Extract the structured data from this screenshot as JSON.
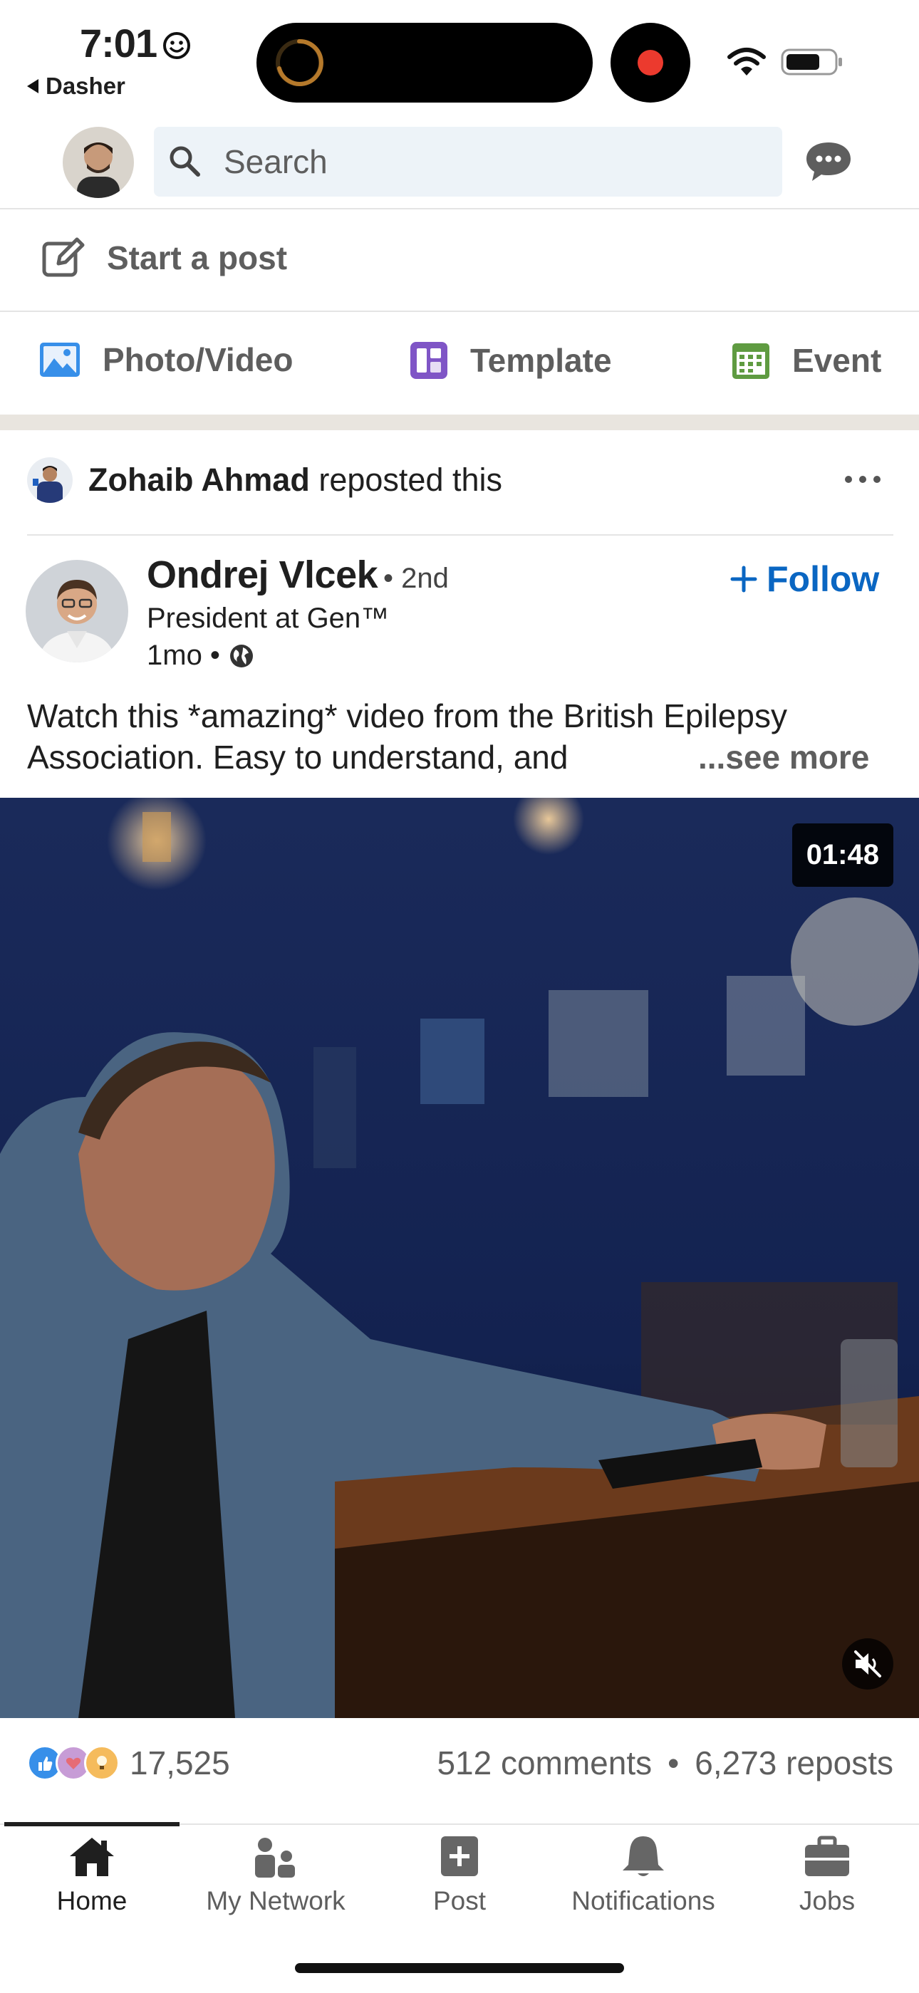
{
  "status_bar": {
    "time": "7:01",
    "back_app": "Dasher"
  },
  "header": {
    "search_placeholder": "Search"
  },
  "composer": {
    "start_post": "Start a post",
    "options": [
      {
        "label": "Photo/Video",
        "icon": "photo-icon",
        "color": "#378fe9"
      },
      {
        "label": "Template",
        "icon": "template-icon",
        "color": "#7f55c6"
      },
      {
        "label": "Event",
        "icon": "calendar-icon",
        "color": "#5f9b41"
      }
    ]
  },
  "post": {
    "reposter": "Zohaib Ahmad",
    "repost_suffix": "reposted this",
    "author": {
      "name": "Ondrej Vlcek",
      "degree": "• 2nd",
      "title": "President at Gen™",
      "time": "1mo •"
    },
    "follow_label": "Follow",
    "text_line1": "Watch this *amazing* video from the British Epilepsy",
    "text_line2": "Association. Easy to understand, and",
    "see_more": "...see more",
    "video_duration": "01:48",
    "reactions_count": "17,525",
    "comments": "512 comments",
    "separator": "•",
    "reposts": "6,273 reposts"
  },
  "tabbar": {
    "tabs": [
      {
        "label": "Home",
        "icon": "home-icon",
        "active": true
      },
      {
        "label": "My Network",
        "icon": "network-icon"
      },
      {
        "label": "Post",
        "icon": "post-icon"
      },
      {
        "label": "Notifications",
        "icon": "bell-icon"
      },
      {
        "label": "Jobs",
        "icon": "briefcase-icon"
      }
    ]
  },
  "colors": {
    "accent": "#0a66c2",
    "muted": "#5e5e5e",
    "search_bg": "#edf3f8"
  }
}
